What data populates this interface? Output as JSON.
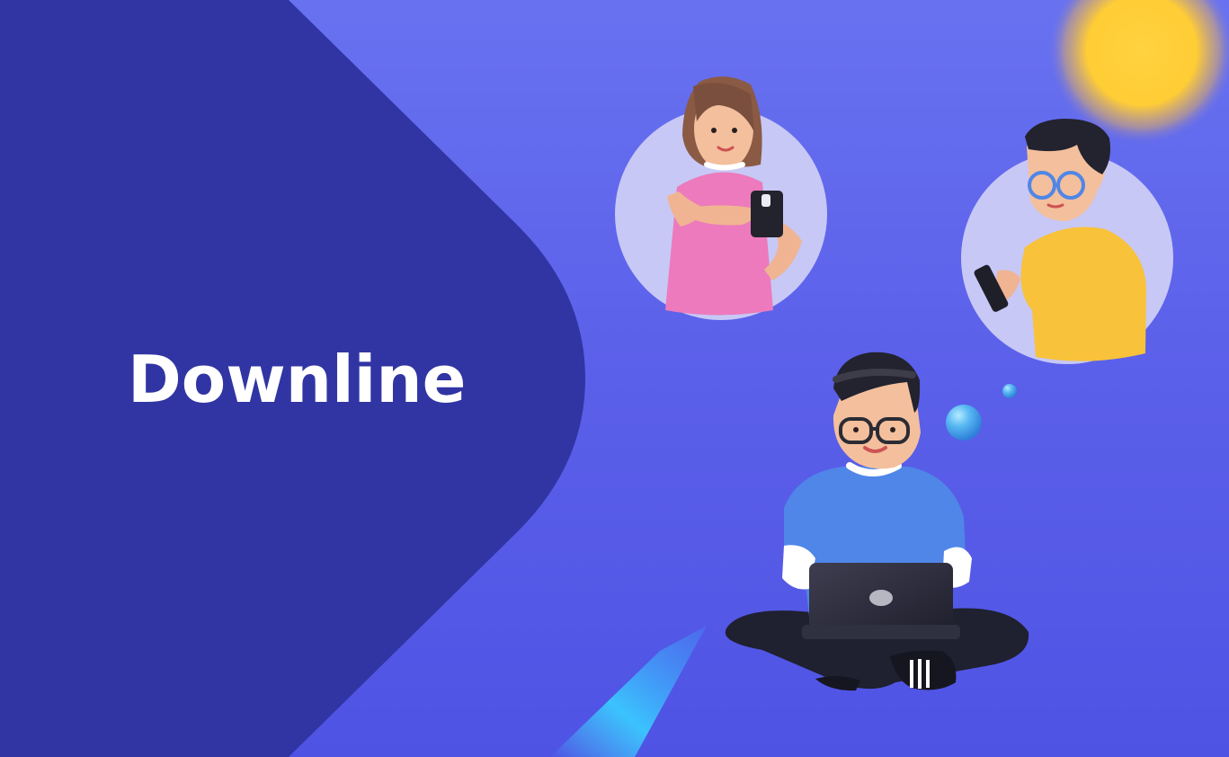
{
  "hero": {
    "title": "Downline"
  },
  "colors": {
    "background": "#5b61ea",
    "panel": "#3135a3",
    "title": "#ffffff",
    "avatar_bubble": "#c7c8f6",
    "sun": "#ffd23f",
    "light_beam": "#39c5ff",
    "woman_shirt": "#ec7abc",
    "man_shirt": "#f8c23a",
    "main_shirt": "#4f86e8",
    "hair_dark": "#1f1f2a",
    "hair_brown": "#8a5a44"
  },
  "illustration": {
    "people": [
      {
        "name": "woman-with-phone",
        "shirt": "pink"
      },
      {
        "name": "man-with-phone",
        "shirt": "yellow"
      },
      {
        "name": "man-with-laptop",
        "shirt": "blue"
      }
    ]
  }
}
